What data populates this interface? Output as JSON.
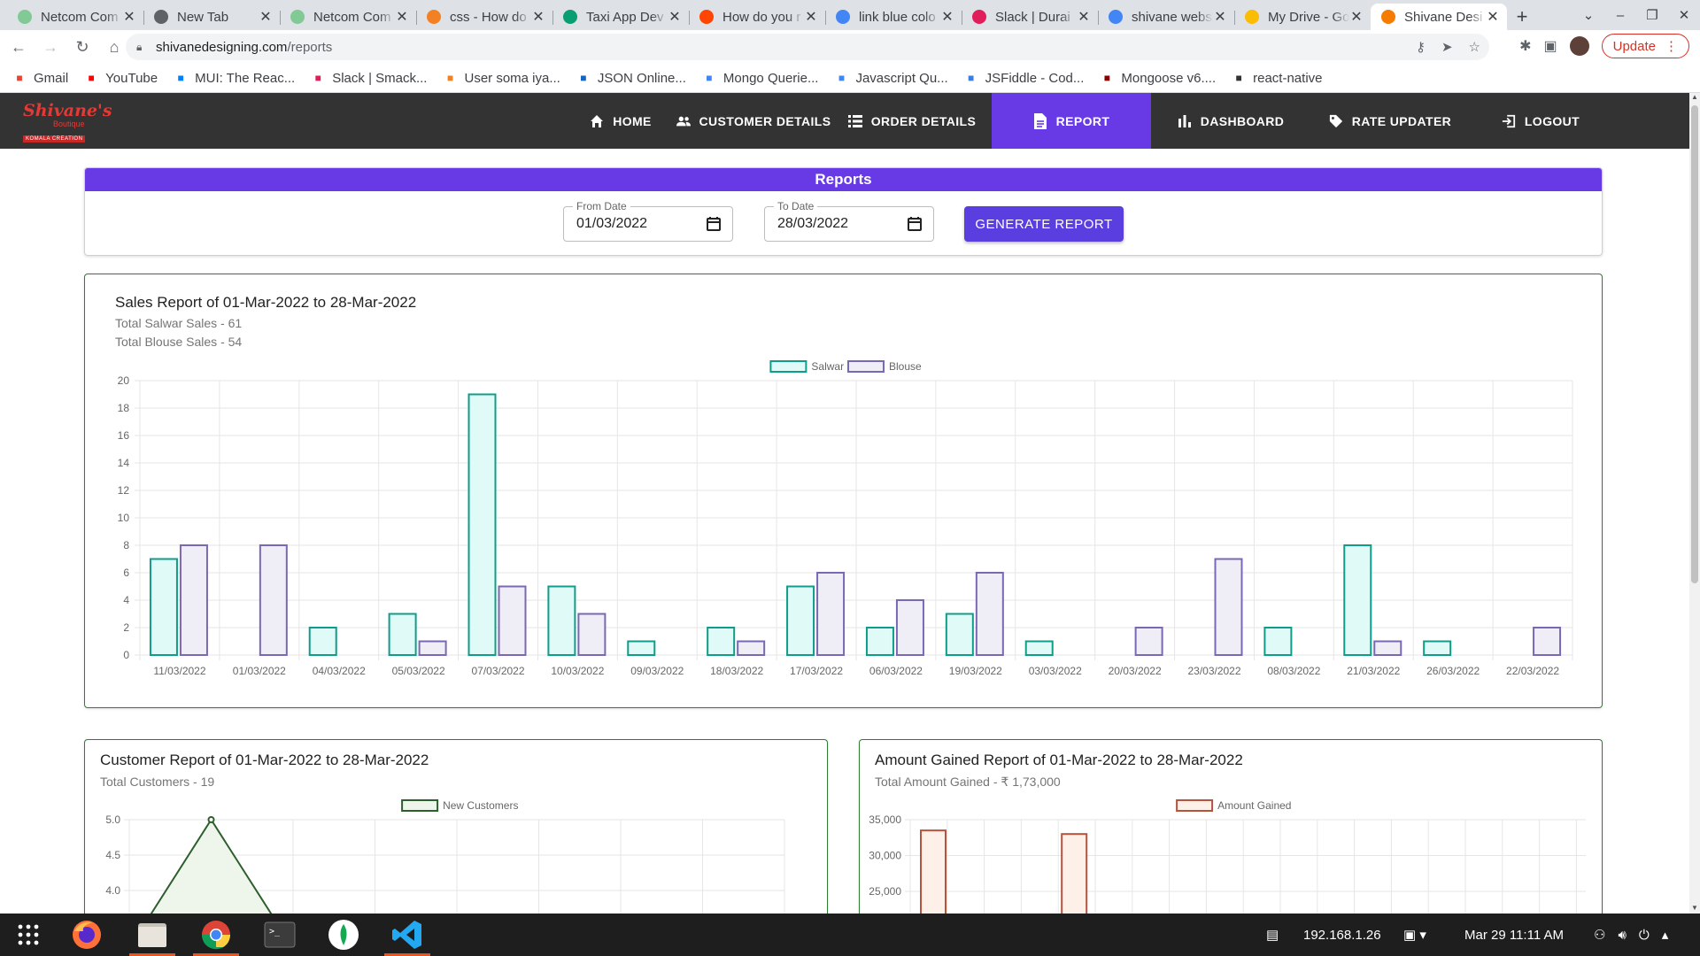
{
  "browser": {
    "tabs": [
      {
        "title": "Netcom Com",
        "favicon_color": "#81c995"
      },
      {
        "title": "New Tab",
        "favicon_color": "#5f6368"
      },
      {
        "title": "Netcom Com",
        "favicon_color": "#81c995"
      },
      {
        "title": "css - How do",
        "favicon_color": "#f48024"
      },
      {
        "title": "Taxi App Dev",
        "favicon_color": "#0a9e73"
      },
      {
        "title": "How do you r",
        "favicon_color": "#ff4500"
      },
      {
        "title": "link blue colo",
        "favicon_color": "#4285f4"
      },
      {
        "title": "Slack | Durai",
        "favicon_color": "#e01e5a"
      },
      {
        "title": "shivane webs",
        "favicon_color": "#4285f4"
      },
      {
        "title": "My Drive - Go",
        "favicon_color": "#fbbc04"
      },
      {
        "title": "Shivane Desi",
        "favicon_color": "#f57c00"
      }
    ],
    "url_host": "shivanedesigning.com",
    "url_path": "/reports",
    "update_label": "Update",
    "bookmarks": [
      {
        "label": "Gmail",
        "icon": "gmail-icon",
        "color": "#ea4335"
      },
      {
        "label": "YouTube",
        "icon": "youtube-icon",
        "color": "#ff0000"
      },
      {
        "label": "MUI: The Reac...",
        "icon": "mui-icon",
        "color": "#007fff"
      },
      {
        "label": "Slack | Smack...",
        "icon": "slack-icon",
        "color": "#e01e5a"
      },
      {
        "label": "User soma iya...",
        "icon": "stackoverflow-icon",
        "color": "#f48024"
      },
      {
        "label": "JSON Online...",
        "icon": "json-icon",
        "color": "#1565c0"
      },
      {
        "label": "Mongo Querie...",
        "icon": "docs-icon",
        "color": "#4285f4"
      },
      {
        "label": "Javascript Qu...",
        "icon": "docs-icon",
        "color": "#4285f4"
      },
      {
        "label": "JSFiddle - Cod...",
        "icon": "jsfiddle-icon",
        "color": "#3a7ee3"
      },
      {
        "label": "Mongoose v6....",
        "icon": "mongoose-icon",
        "color": "#880000"
      },
      {
        "label": "react-native",
        "icon": "expo-icon",
        "color": "#333333"
      }
    ]
  },
  "app": {
    "logo": {
      "line1": "Shivane's",
      "line2": "Boutique",
      "line3": "KOMALA CREATION"
    },
    "menu": [
      {
        "label": "HOME",
        "icon": "home-icon"
      },
      {
        "label": "CUSTOMER DETAILS",
        "icon": "people-icon"
      },
      {
        "label": "ORDER DETAILS",
        "icon": "list-icon"
      },
      {
        "label": "REPORT",
        "icon": "report-icon",
        "active": true
      },
      {
        "label": "DASHBOARD",
        "icon": "bar-chart-icon"
      },
      {
        "label": "RATE UPDATER",
        "icon": "tag-icon"
      },
      {
        "label": "LOGOUT",
        "icon": "logout-icon"
      }
    ],
    "accent_color": "#673ae6"
  },
  "reports": {
    "title": "Reports",
    "from_label": "From Date",
    "from_value": "01/03/2022",
    "to_label": "To Date",
    "to_value": "28/03/2022",
    "generate_label": "GENERATE REPORT"
  },
  "sales": {
    "title": "Sales Report of 01-Mar-2022 to 28-Mar-2022",
    "total_salwar": "Total Salwar Sales - 61",
    "total_blouse": "Total Blouse Sales - 54"
  },
  "customers": {
    "title": "Customer Report of 01-Mar-2022 to 28-Mar-2022",
    "total": "Total Customers - 19"
  },
  "amount": {
    "title": "Amount Gained Report of 01-Mar-2022 to 28-Mar-2022",
    "total": "Total Amount Gained - ₹ 1,73,000"
  },
  "chart_data": [
    {
      "type": "bar",
      "categories": [
        "11/03/2022",
        "01/03/2022",
        "04/03/2022",
        "05/03/2022",
        "07/03/2022",
        "10/03/2022",
        "09/03/2022",
        "18/03/2022",
        "17/03/2022",
        "06/03/2022",
        "19/03/2022",
        "03/03/2022",
        "20/03/2022",
        "23/03/2022",
        "08/03/2022",
        "21/03/2022",
        "26/03/2022",
        "22/03/2022"
      ],
      "series": [
        {
          "name": "Salwar",
          "color": "#0f9d8a",
          "fill": "#e0faf7",
          "values": [
            7,
            0,
            2,
            3,
            19,
            5,
            1,
            2,
            5,
            2,
            3,
            1,
            0,
            0,
            2,
            8,
            1,
            0
          ]
        },
        {
          "name": "Blouse",
          "color": "#7b68b3",
          "fill": "#efedf6",
          "values": [
            8,
            8,
            0,
            1,
            5,
            3,
            0,
            1,
            6,
            4,
            6,
            0,
            2,
            7,
            0,
            1,
            0,
            2
          ]
        }
      ],
      "ylim": [
        0,
        20
      ],
      "yticks": [
        0,
        2,
        4,
        6,
        8,
        10,
        12,
        14,
        16,
        18,
        20
      ],
      "legend": "top-center",
      "grid": true
    },
    {
      "type": "line",
      "series": [
        {
          "name": "New Customers",
          "color": "#2e5e2e",
          "fill": "#eef6ec",
          "values": [
            3.5,
            5.0,
            3.5
          ]
        }
      ],
      "yticks": [
        4.0,
        4.5,
        5.0
      ],
      "legend": "top-center",
      "grid": true
    },
    {
      "type": "bar",
      "series": [
        {
          "name": "Amount Gained",
          "color": "#b5533c",
          "fill": "#fdf0e9",
          "values": [
            33500,
            0,
            0,
            33000
          ]
        }
      ],
      "yticks": [
        25000,
        30000,
        35000
      ],
      "ytick_labels": [
        "25,000",
        "30,000",
        "35,000"
      ],
      "legend": "top-center",
      "grid": true
    }
  ],
  "taskbar": {
    "ip": "192.168.1.26",
    "datetime": "Mar 29  11:11 AM"
  }
}
